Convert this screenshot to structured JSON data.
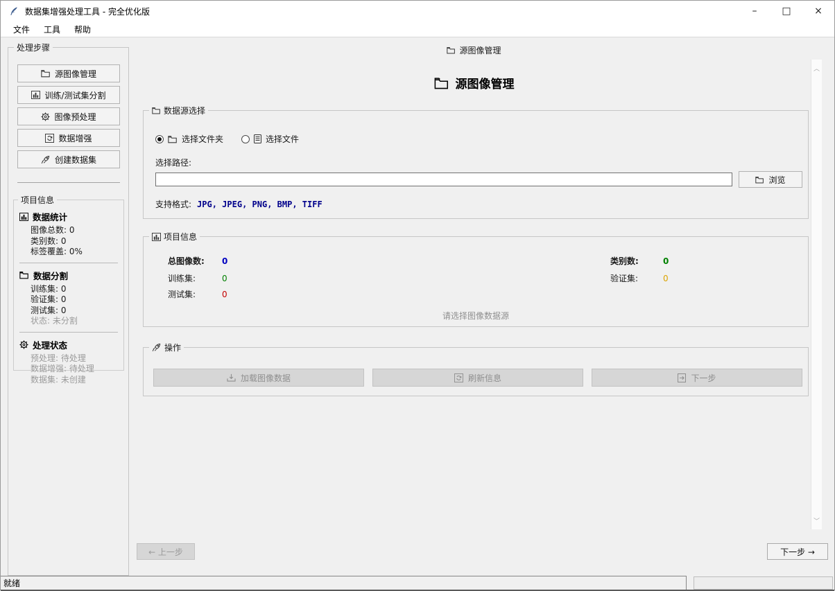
{
  "window": {
    "title": "数据集增强处理工具 - 完全优化版",
    "controls": {
      "minimize": "–",
      "maximize": "□",
      "close": "×"
    }
  },
  "menu": {
    "items": [
      {
        "label": "文件"
      },
      {
        "label": "工具"
      },
      {
        "label": "帮助"
      }
    ]
  },
  "sidebar": {
    "steps_title": "处理步骤",
    "steps": [
      {
        "icon": "folder-icon",
        "label": "源图像管理"
      },
      {
        "icon": "bar-chart-icon",
        "label": "训练/测试集分割"
      },
      {
        "icon": "gear-icon",
        "label": "图像预处理"
      },
      {
        "icon": "augment-icon",
        "label": "数据增强"
      },
      {
        "icon": "rocket-icon",
        "label": "创建数据集"
      }
    ],
    "project_info": {
      "title": "项目信息",
      "stats_section": {
        "icon": "bar-chart-icon",
        "title": "数据统计",
        "rows": [
          {
            "label": "图像总数:",
            "value": "0"
          },
          {
            "label": "类别数:",
            "value": "0"
          },
          {
            "label": "标签覆盖:",
            "value": "0%"
          }
        ]
      },
      "split_section": {
        "icon": "folder-icon",
        "title": "数据分割",
        "rows": [
          {
            "label": "训练集:",
            "value": "0"
          },
          {
            "label": "验证集:",
            "value": "0"
          },
          {
            "label": "测试集:",
            "value": "0"
          },
          {
            "label": "状态:",
            "value": "未分割",
            "muted": true
          }
        ]
      },
      "status_section": {
        "icon": "gear-icon",
        "title": "处理状态",
        "rows": [
          {
            "label": "预处理:",
            "value": "待处理",
            "muted": true
          },
          {
            "label": "数据增强:",
            "value": "待处理",
            "muted": true
          },
          {
            "label": "数据集:",
            "value": "未创建",
            "muted": true
          }
        ]
      }
    }
  },
  "main": {
    "tab_label": "源图像管理",
    "page_title": "源图像管理",
    "source_group": {
      "title": "数据源选择",
      "radio_folder": {
        "label": "选择文件夹",
        "selected": true
      },
      "radio_file": {
        "label": "选择文件",
        "selected": false
      },
      "path_label": "选择路径:",
      "path_value": "",
      "browse_label": "浏览",
      "formats_label": "支持格式:",
      "formats_value": "JPG, JPEG, PNG, BMP, TIFF"
    },
    "info_group": {
      "title": "项目信息",
      "rows": [
        {
          "l1": "总图像数:",
          "v1": "0",
          "l2": "类别数:",
          "v2": "0"
        },
        {
          "l1": "训练集:",
          "v1": "0",
          "l2": "验证集:",
          "v2": "0"
        },
        {
          "l1": "测试集:",
          "v1": "0",
          "l2": "",
          "v2": ""
        }
      ],
      "hint": "请选择图像数据源"
    },
    "actions_group": {
      "title": "操作",
      "buttons": [
        {
          "icon": "load-icon",
          "label": "加载图像数据",
          "enabled": false
        },
        {
          "icon": "refresh-icon",
          "label": "刷新信息",
          "enabled": false
        },
        {
          "icon": "next-icon",
          "label": "下一步",
          "enabled": false
        }
      ]
    },
    "nav": {
      "prev": "← 上一步",
      "next": "下一步 →"
    },
    "scrollbar": {
      "up": "︿",
      "down": "﹀"
    }
  },
  "statusbar": {
    "text": "就绪"
  },
  "icons": {
    "python-feather-icon": "quill feather (app logo)",
    "folder-icon": "open folder outline",
    "bar-chart-icon": "bar chart",
    "gear-icon": "gear",
    "augment-icon": "refresh arrows in box",
    "rocket-icon": "rocket",
    "file-icon": "document sheet",
    "load-icon": "upload tray",
    "refresh-icon": "refresh in box",
    "next-icon": "arrow in box"
  },
  "colors": {
    "background": "#f0f0f0",
    "titlebar": "#ffffff",
    "value_blue": "#0000c0",
    "value_green": "#008000",
    "value_orange": "#dba400",
    "value_red": "#c40000",
    "formats_blue": "#00008b",
    "muted_text": "#9b9b9b"
  }
}
